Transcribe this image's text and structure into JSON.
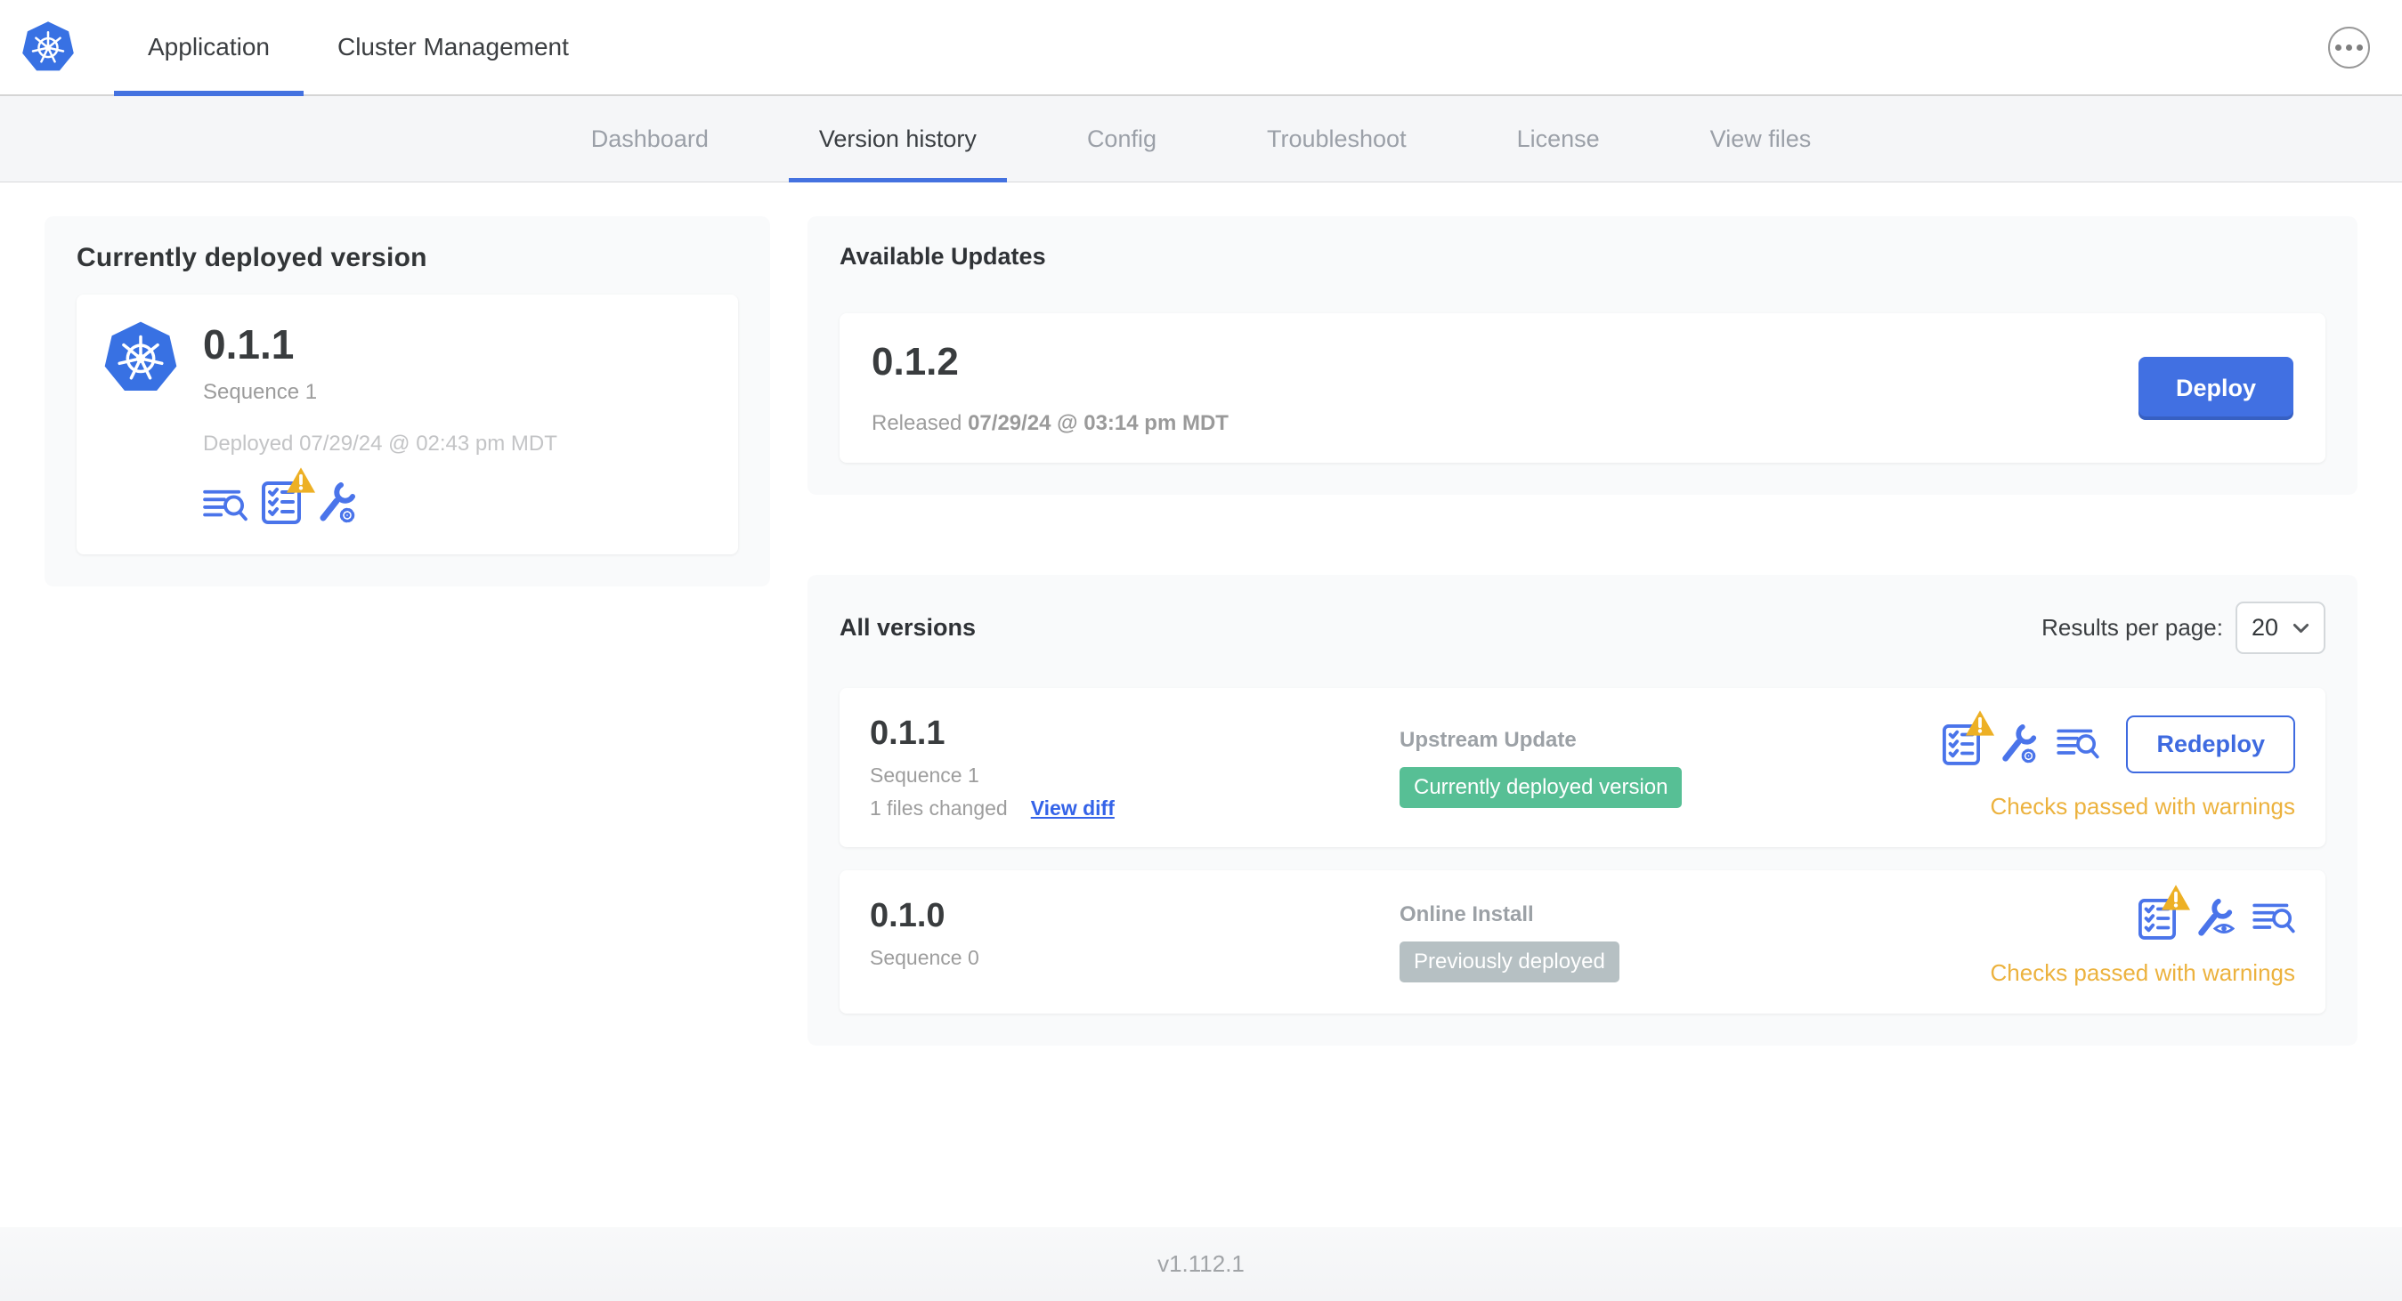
{
  "header": {
    "tabs": [
      {
        "label": "Application",
        "active": true
      },
      {
        "label": "Cluster Management",
        "active": false
      }
    ],
    "overflow_menu_icon": "ellipsis-icon",
    "logo_icon": "kubernetes-logo-icon"
  },
  "subnav": {
    "tabs": [
      {
        "label": "Dashboard",
        "active": false
      },
      {
        "label": "Version history",
        "active": true
      },
      {
        "label": "Config",
        "active": false
      },
      {
        "label": "Troubleshoot",
        "active": false
      },
      {
        "label": "License",
        "active": false
      },
      {
        "label": "View files",
        "active": false
      }
    ]
  },
  "current_version": {
    "title": "Currently deployed version",
    "version": "0.1.1",
    "sequence": "Sequence 1",
    "deployed": "Deployed 07/29/24 @ 02:43 pm MDT",
    "icons": [
      "logs-icon",
      "preflight-checks-warning-icon",
      "edit-config-icon"
    ]
  },
  "available_updates": {
    "title": "Available Updates",
    "version": "0.1.2",
    "released_prefix": "Released",
    "released_date": "07/29/24 @ 03:14 pm MDT",
    "deploy_label": "Deploy"
  },
  "all_versions": {
    "title": "All versions",
    "results_per_page_label": "Results per page:",
    "results_per_page_value": "20",
    "rows": [
      {
        "version": "0.1.1",
        "sequence": "Sequence 1",
        "files_changed": "1 files changed",
        "view_diff_label": "View diff",
        "source": "Upstream Update",
        "status_badge": "Currently deployed version",
        "status_badge_color": "#57bf95",
        "icons": [
          "preflight-checks-warning-icon",
          "edit-config-icon",
          "logs-icon"
        ],
        "action_label": "Redeploy",
        "checks_text": "Checks passed with warnings"
      },
      {
        "version": "0.1.0",
        "sequence": "Sequence 0",
        "source": "Online Install",
        "status_badge": "Previously deployed",
        "status_badge_color": "#b6c0c3",
        "icons": [
          "preflight-checks-warning-icon",
          "view-config-icon",
          "logs-icon"
        ],
        "checks_text": "Checks passed with warnings"
      }
    ]
  },
  "footer": {
    "app_version": "v1.112.1"
  },
  "colors": {
    "accent_blue": "#4170e2",
    "icon_blue": "#4a74ea",
    "link_blue": "#3463e8",
    "badge_green": "#57bf95",
    "badge_gray": "#b6c0c3",
    "warning_amber": "#edb025",
    "checks_orange": "#ecb23e",
    "kubernetes_blue": "#3871e3"
  }
}
